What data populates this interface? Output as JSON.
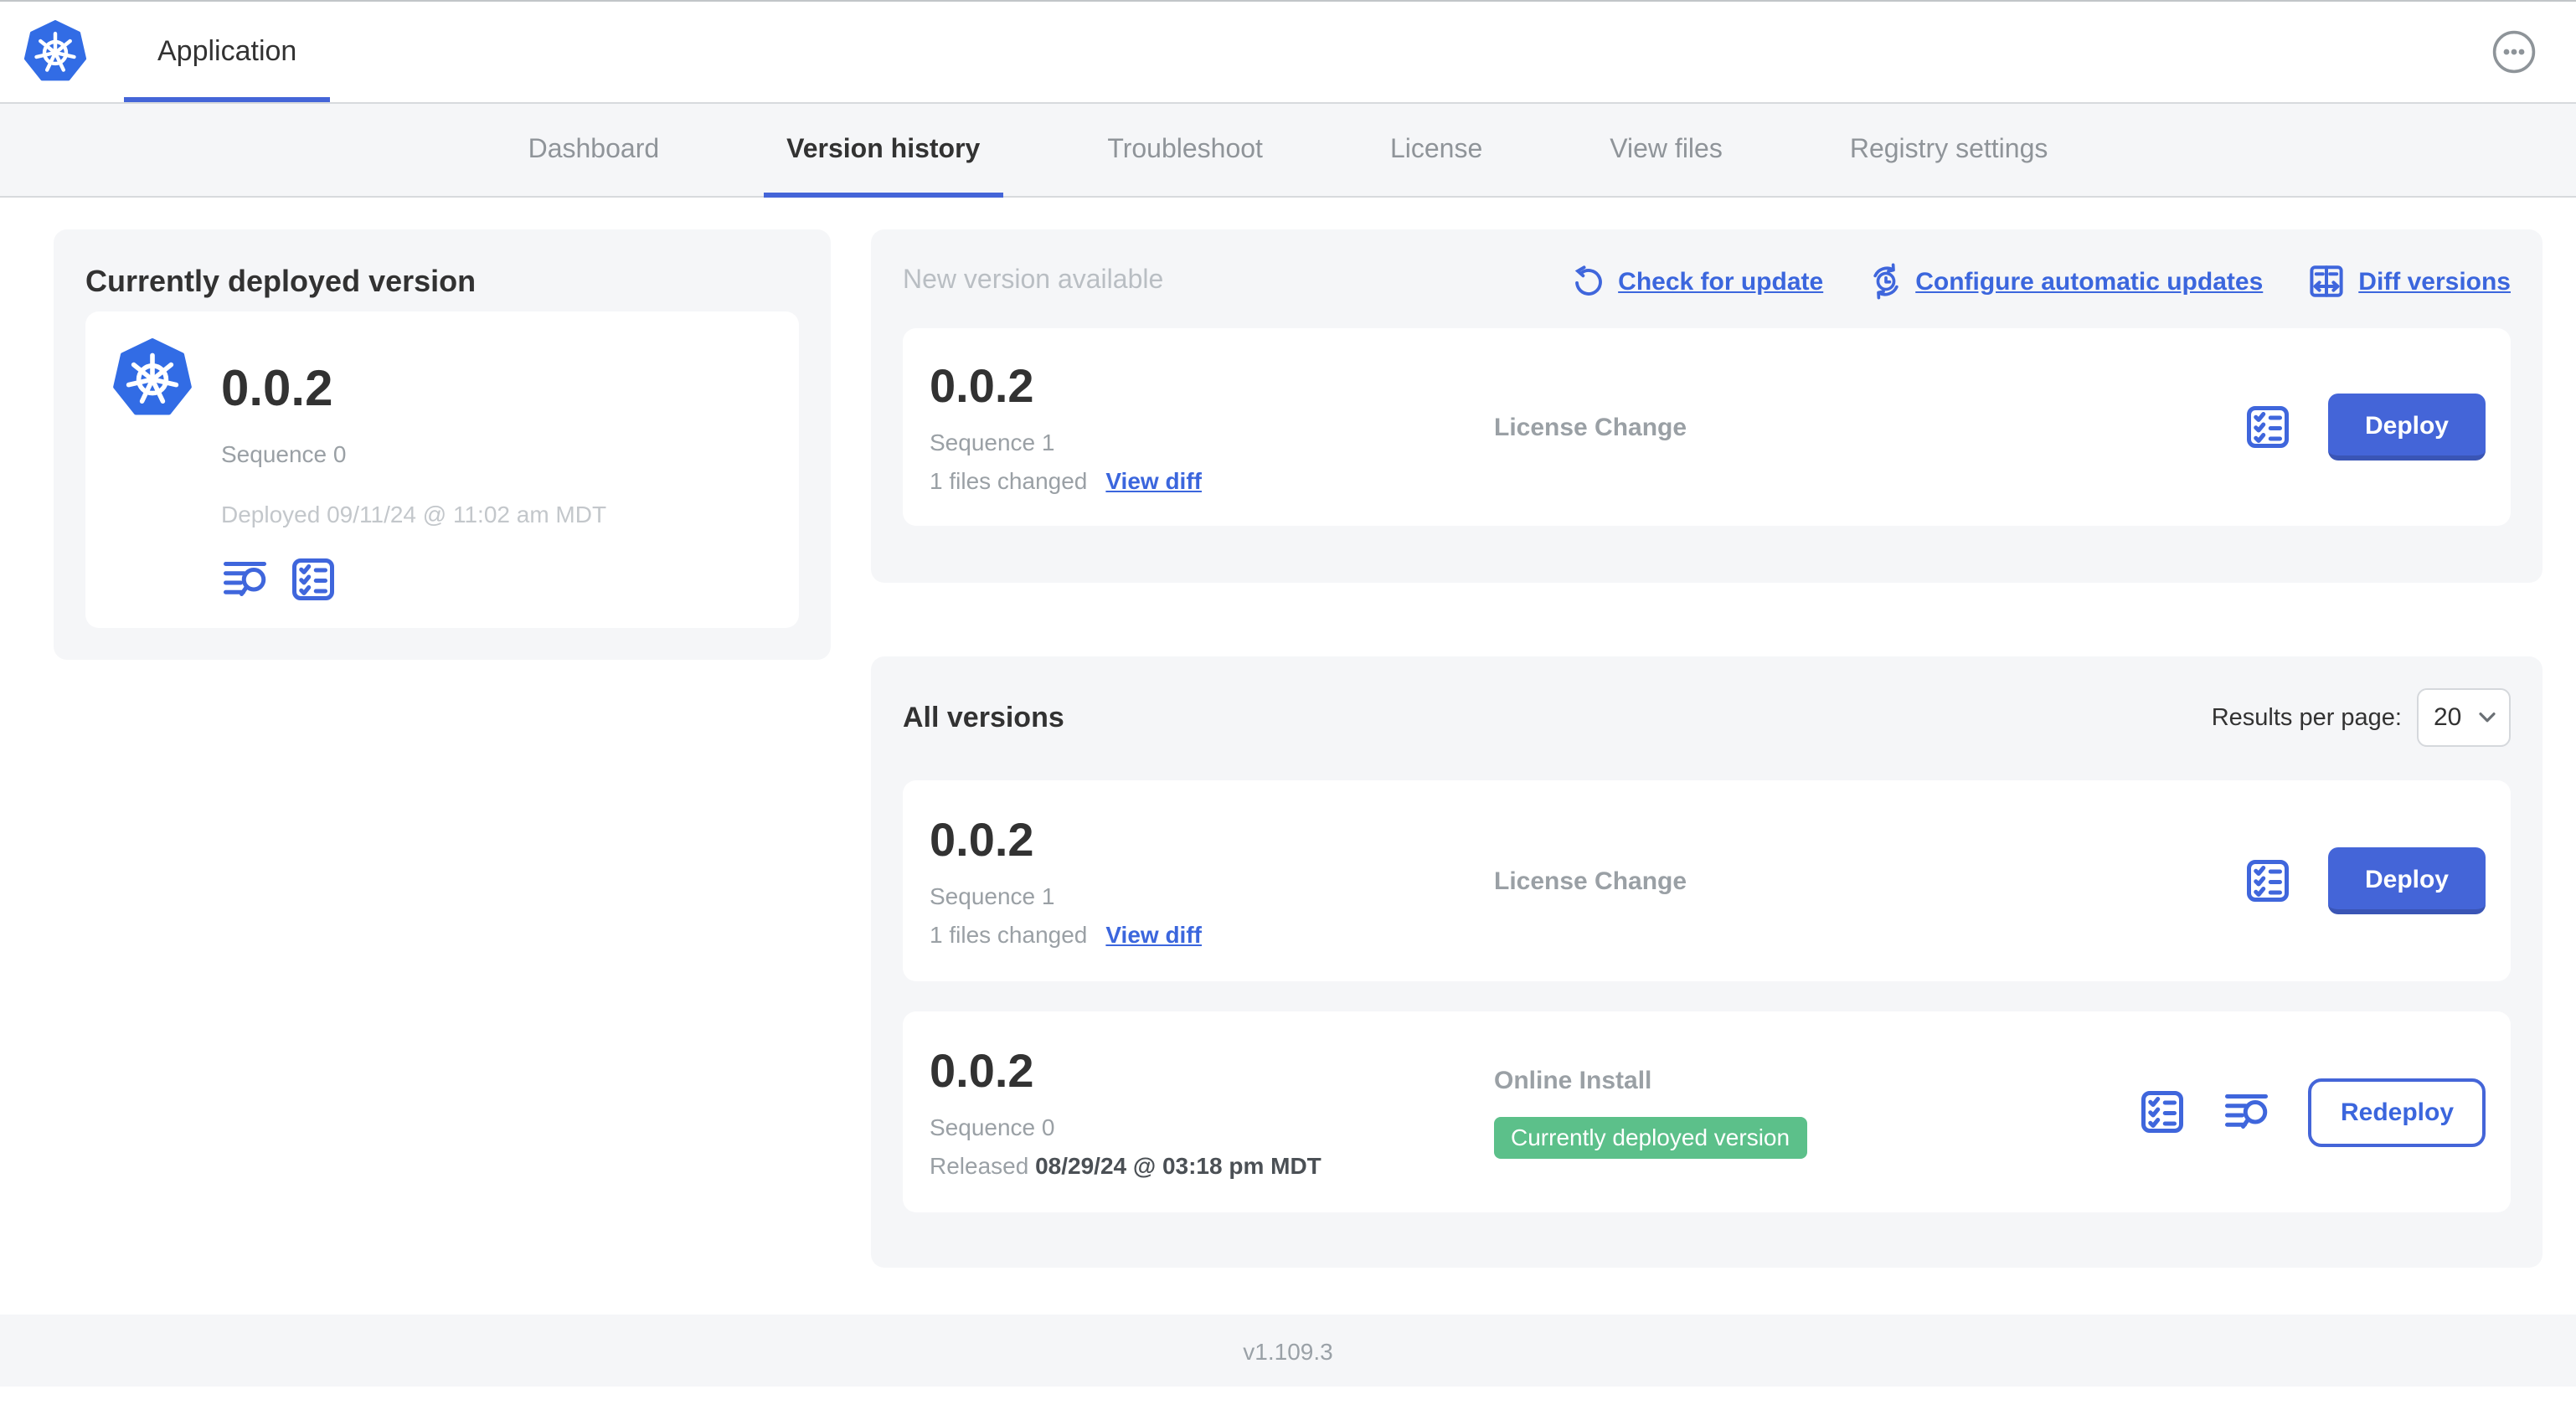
{
  "header": {
    "app_name": "Application"
  },
  "nav": {
    "active_tab": "Version history",
    "tabs": [
      {
        "label": "Dashboard"
      },
      {
        "label": "Version history"
      },
      {
        "label": "Troubleshoot"
      },
      {
        "label": "License"
      },
      {
        "label": "View files"
      },
      {
        "label": "Registry settings"
      }
    ]
  },
  "currently_deployed": {
    "title": "Currently deployed version",
    "version": "0.0.2",
    "sequence": "Sequence 0",
    "deployed_at": "Deployed 09/11/24 @ 11:02 am MDT"
  },
  "new_version": {
    "title": "New version available",
    "actions": {
      "check_for_update": "Check for update",
      "configure_automatic_updates": "Configure automatic updates",
      "diff_versions": "Diff versions"
    },
    "card": {
      "version": "0.0.2",
      "sequence": "Sequence 1",
      "files_changed": "1 files changed",
      "view_diff": "View diff",
      "source": "License Change",
      "deploy_label": "Deploy"
    }
  },
  "all_versions": {
    "title": "All versions",
    "results_per_page_label": "Results per page:",
    "results_per_page_value": "20",
    "rows": [
      {
        "version": "0.0.2",
        "sequence": "Sequence 1",
        "files_changed": "1 files changed",
        "view_diff": "View diff",
        "source": "License Change",
        "action_label": "Deploy"
      },
      {
        "version": "0.0.2",
        "sequence": "Sequence 0",
        "released_prefix": "Released",
        "released_date": "08/29/24 @ 03:18 pm MDT",
        "source": "Online Install",
        "badge": "Currently deployed version",
        "action_label": "Redeploy"
      }
    ]
  },
  "footer": {
    "version": "v1.109.3"
  },
  "colors": {
    "primary_blue": "#4465d8",
    "link_blue": "#3b66dd",
    "kubernetes_blue": "#326ce5",
    "badge_green": "#5cc08a",
    "panel_gray": "#f5f6f8"
  }
}
